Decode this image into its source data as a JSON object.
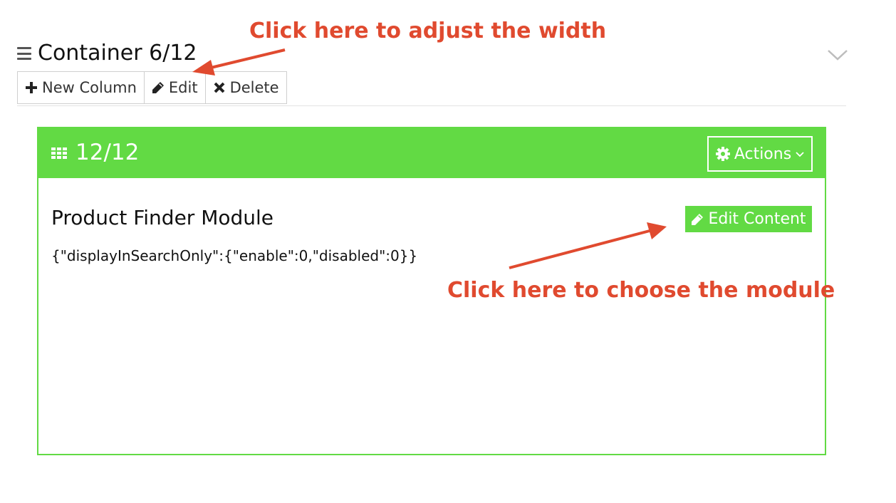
{
  "container": {
    "title": "Container 6/12",
    "toolbar": {
      "new_column_label": "New Column",
      "edit_label": "Edit",
      "delete_label": "Delete"
    }
  },
  "column": {
    "width_label": "12/12",
    "actions_label": "Actions",
    "module": {
      "title": "Product Finder Module",
      "config": "{\"displayInSearchOnly\":{\"enable\":0,\"disabled\":0}}",
      "edit_content_label": "Edit Content"
    }
  },
  "annotations": {
    "width_note": "Click here to adjust the width",
    "module_note": "Click here to choose the module"
  },
  "colors": {
    "accent_green": "#62da44",
    "annotation_red": "#e04a2f",
    "border_gray": "#cfcfcf"
  },
  "icons": [
    "drag-handle-icon",
    "chevron-down-icon",
    "plus-icon",
    "pencil-icon",
    "close-icon",
    "grid-icon",
    "gear-icon"
  ]
}
